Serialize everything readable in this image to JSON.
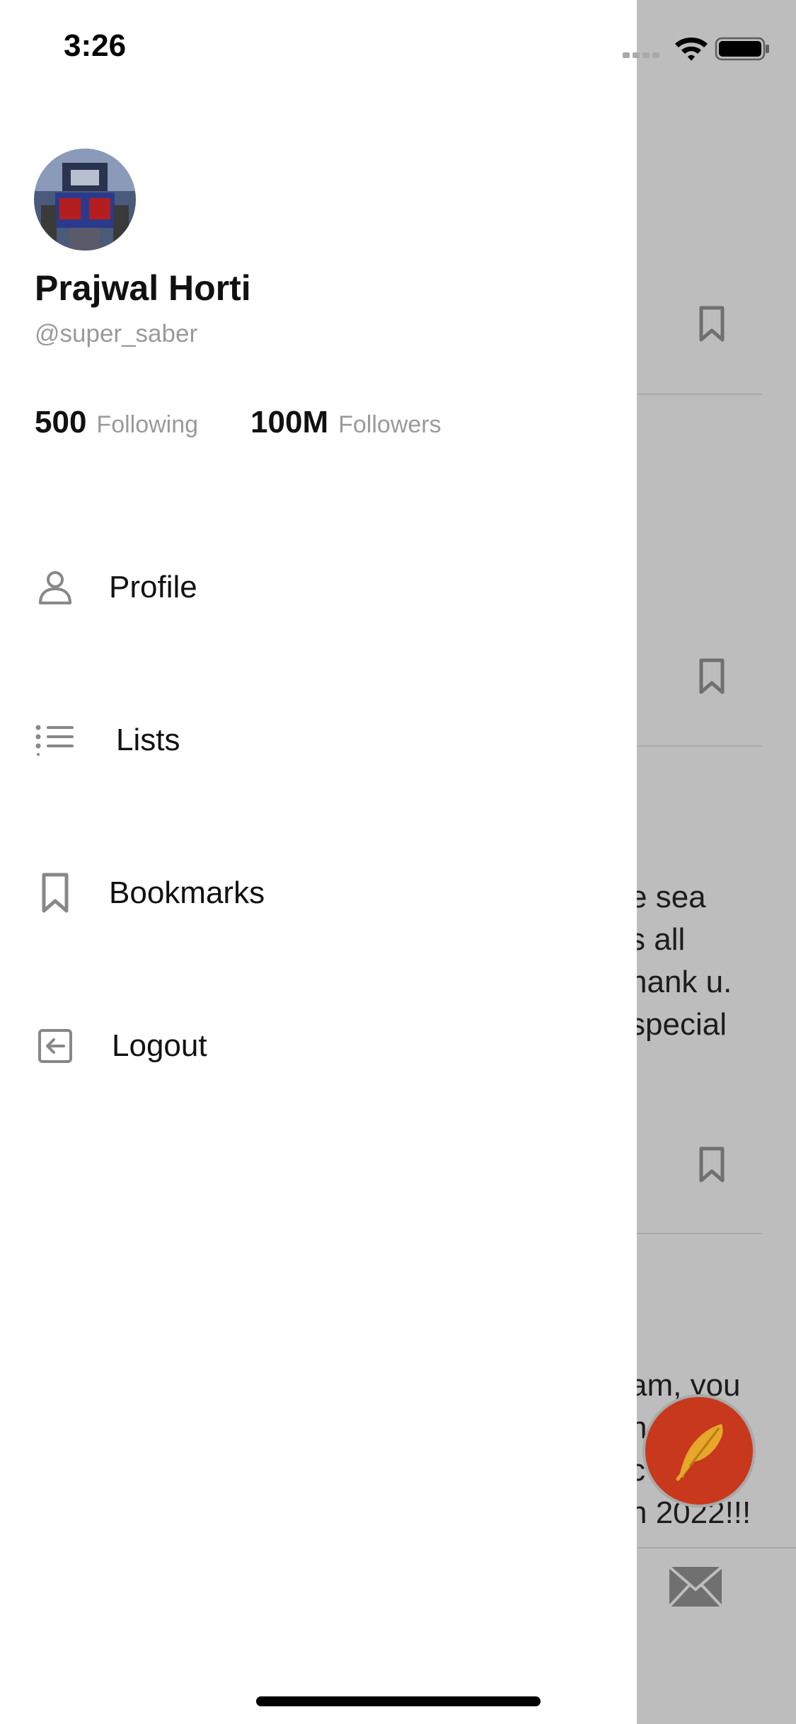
{
  "status_bar": {
    "time": "3:26"
  },
  "profile": {
    "name": "Prajwal Horti",
    "handle": "@super_saber",
    "following_count": "500",
    "following_label": "Following",
    "followers_count": "100M",
    "followers_label": "Followers"
  },
  "menu": {
    "items": [
      {
        "label": "Profile",
        "icon": "person-icon"
      },
      {
        "label": "Lists",
        "icon": "list-icon"
      },
      {
        "label": "Bookmarks",
        "icon": "bookmark-icon"
      },
      {
        "label": "Logout",
        "icon": "logout-icon"
      }
    ]
  },
  "feed": {
    "post_3_lines": [
      "e sea",
      "s all",
      "hank u.",
      "special"
    ],
    "post_4_lines": [
      "am, you",
      "h",
      "c",
      "n 2022!!!"
    ]
  },
  "colors": {
    "drawer_bg": "#ffffff",
    "overlay_gray": "#bdbdbd",
    "fab_red": "#c8381d",
    "muted_text": "#9a9a9a",
    "icon_gray": "#888888"
  }
}
